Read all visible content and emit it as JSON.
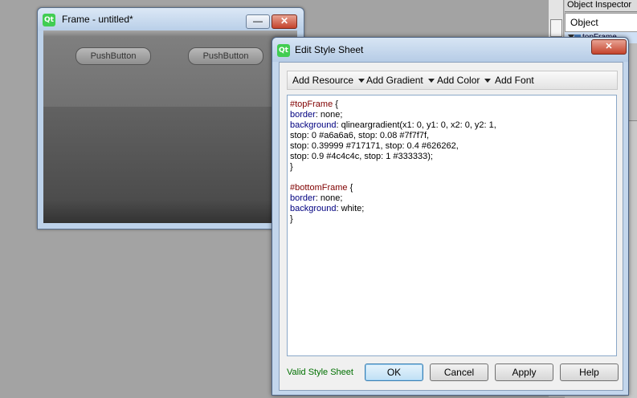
{
  "inspector": {
    "title": "Object Inspector",
    "header": "Object",
    "row_label": "topFrame"
  },
  "frame_window": {
    "title": "Frame - untitled*",
    "buttons": [
      "PushButton",
      "PushButton"
    ],
    "minimize_glyph": "—",
    "close_glyph": "✕"
  },
  "dialog": {
    "title": "Edit Style Sheet",
    "close_glyph": "✕",
    "toolbar": {
      "add_resource": "Add Resource",
      "add_gradient": "Add Gradient",
      "add_color": "Add Color",
      "add_font": "Add Font"
    },
    "editor_lines": [
      [
        {
          "t": "#topFrame",
          "c": "sel"
        },
        {
          "t": " {",
          "c": ""
        }
      ],
      [
        {
          "t": "border",
          "c": "prop"
        },
        {
          "t": ": none;",
          "c": ""
        }
      ],
      [
        {
          "t": "background",
          "c": "prop"
        },
        {
          "t": ": qlineargradient(x1: 0, y1: 0, x2: 0, y2: 1,",
          "c": ""
        }
      ],
      [
        {
          "t": "stop: 0 #a6a6a6, stop: 0.08 #7f7f7f,",
          "c": ""
        }
      ],
      [
        {
          "t": "stop: 0.39999 #717171, stop: 0.4 #626262,",
          "c": ""
        }
      ],
      [
        {
          "t": "stop: 0.9 #4c4c4c, stop: 1 #333333);",
          "c": ""
        }
      ],
      [
        {
          "t": "}",
          "c": ""
        }
      ],
      [
        {
          "t": "",
          "c": ""
        }
      ],
      [
        {
          "t": "#bottomFrame",
          "c": "sel"
        },
        {
          "t": " {",
          "c": ""
        }
      ],
      [
        {
          "t": "border",
          "c": "prop"
        },
        {
          "t": ": none;",
          "c": ""
        }
      ],
      [
        {
          "t": "background",
          "c": "prop"
        },
        {
          "t": ": white;",
          "c": ""
        }
      ],
      [
        {
          "t": "}",
          "c": ""
        }
      ]
    ],
    "status": "Valid Style Sheet",
    "buttons": {
      "ok": "OK",
      "cancel": "Cancel",
      "apply": "Apply",
      "help": "Help"
    }
  },
  "colors": {
    "valid_text": "#007000",
    "selector": "#800000",
    "property": "#000080"
  }
}
